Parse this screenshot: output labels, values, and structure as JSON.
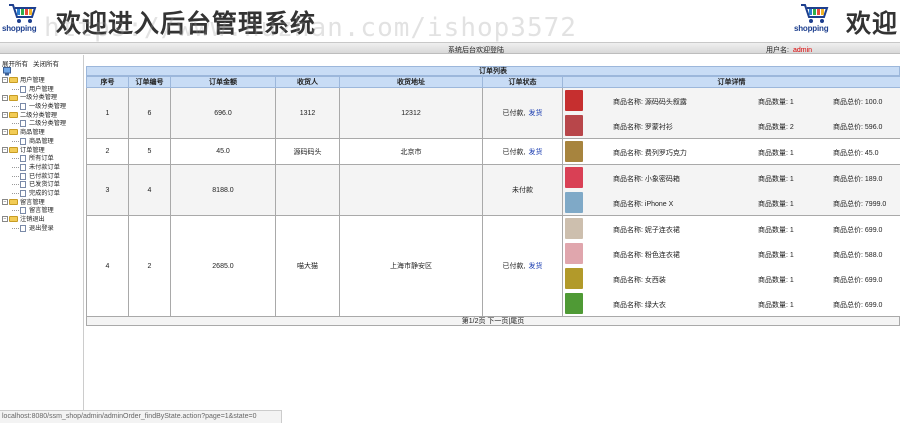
{
  "banner": {
    "logo_text": "shopping",
    "title": "欢迎进入后台管理系统",
    "title_right": "欢迎",
    "watermark": "https://www.huzhan.com/ishop3572"
  },
  "statusbar": {
    "welcome": "系统后台欢迎登陆",
    "user_label": "用户名:",
    "user_name": "admin"
  },
  "sidebar": {
    "expand_all": "展开所有",
    "collapse_all": "关闭所有",
    "tree": [
      {
        "label": "用户管理",
        "type": "folder"
      },
      {
        "label": "用户管理",
        "type": "leaf"
      },
      {
        "label": "一级分类管理",
        "type": "folder"
      },
      {
        "label": "一级分类管理",
        "type": "leaf"
      },
      {
        "label": "二级分类管理",
        "type": "folder"
      },
      {
        "label": "二级分类管理",
        "type": "leaf"
      },
      {
        "label": "商品管理",
        "type": "folder"
      },
      {
        "label": "商品管理",
        "type": "leaf"
      },
      {
        "label": "订单管理",
        "type": "folder"
      },
      {
        "label": "所有订单",
        "type": "leaf"
      },
      {
        "label": "未付款订单",
        "type": "leaf"
      },
      {
        "label": "已付款订单",
        "type": "leaf"
      },
      {
        "label": "已发货订单",
        "type": "leaf"
      },
      {
        "label": "完成的订单",
        "type": "leaf"
      },
      {
        "label": "留言管理",
        "type": "folder"
      },
      {
        "label": "留言管理",
        "type": "leaf"
      },
      {
        "label": "注销退出",
        "type": "folder"
      },
      {
        "label": "退出登录",
        "type": "leaf"
      }
    ]
  },
  "orders": {
    "title": "订单列表",
    "columns": [
      "序号",
      "订单编号",
      "订单金额",
      "收货人",
      "收货地址",
      "订单状态",
      "订单详情"
    ],
    "name_label": "商品名称:",
    "qty_label": "商品数量:",
    "total_label": "商品总价:",
    "rows": [
      {
        "seq": "1",
        "oid": "6",
        "amount": "696.0",
        "receiver": "1312",
        "address": "12312",
        "status": "已付款,",
        "action": "发货",
        "items": [
          {
            "name": "源码码头叙露",
            "qty": "1",
            "total": "100.0",
            "thumb": "#c62f2f"
          },
          {
            "name": "罗蒙衬衫",
            "qty": "2",
            "total": "596.0",
            "thumb": "#b8464a"
          }
        ]
      },
      {
        "seq": "2",
        "oid": "5",
        "amount": "45.0",
        "receiver": "源码码头",
        "address": "北京市",
        "status": "已付款,",
        "action": "发货",
        "items": [
          {
            "name": "费列罗巧克力",
            "qty": "1",
            "total": "45.0",
            "thumb": "#a7843e"
          }
        ]
      },
      {
        "seq": "3",
        "oid": "4",
        "amount": "8188.0",
        "receiver": "",
        "address": "",
        "status": "未付款",
        "action": "",
        "items": [
          {
            "name": "小象密码箱",
            "qty": "1",
            "total": "189.0",
            "thumb": "#d94055"
          },
          {
            "name": "iPhone X",
            "qty": "1",
            "total": "7999.0",
            "thumb": "#7fa9c7"
          }
        ]
      },
      {
        "seq": "4",
        "oid": "2",
        "amount": "2685.0",
        "receiver": "喵大猫",
        "address": "上海市静安区",
        "status": "已付款,",
        "action": "发货",
        "items": [
          {
            "name": "妮子连衣裙",
            "qty": "1",
            "total": "699.0",
            "thumb": "#cdbfae"
          },
          {
            "name": "粉色连衣裙",
            "qty": "1",
            "total": "588.0",
            "thumb": "#e0a6ad"
          },
          {
            "name": "女西装",
            "qty": "1",
            "total": "699.0",
            "thumb": "#b29a2a"
          },
          {
            "name": "绿大衣",
            "qty": "1",
            "total": "699.0",
            "thumb": "#4f9a35"
          }
        ]
      }
    ],
    "pager": {
      "page_info": "第1/2页",
      "next": "下一页",
      "last": "尾页"
    }
  },
  "url_status": "localhost:8080/ssm_shop/admin/adminOrder_findByState.action?page=1&state=0"
}
